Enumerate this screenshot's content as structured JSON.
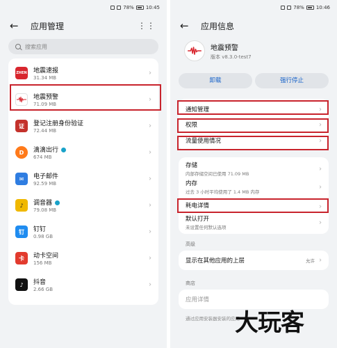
{
  "left": {
    "status": {
      "battery": "78%",
      "time": "10:45"
    },
    "title": "应用管理",
    "more": "⋮⋮",
    "search_placeholder": "搜索应用",
    "apps": [
      {
        "name": "地震速报",
        "size": "31.34 MB",
        "icon_color": "#d8262e",
        "icon_text": "ZHEN"
      },
      {
        "name": "地震预警",
        "size": "71.09 MB",
        "icon_color": "#ffffff",
        "icon_text": ""
      },
      {
        "name": "登记注册身份验证",
        "size": "72.44 MB",
        "icon_color": "#c4322c",
        "icon_text": "证"
      },
      {
        "name": "滴滴出行",
        "size": "674 MB",
        "icon_color": "#ff7a1a",
        "icon_text": "D"
      },
      {
        "name": "电子邮件",
        "size": "92.59 MB",
        "icon_color": "#2f7de1",
        "icon_text": "✉"
      },
      {
        "name": "调音器",
        "size": "79.08 MB",
        "icon_color": "#f0b800",
        "icon_text": "♪"
      },
      {
        "name": "钉钉",
        "size": "0.98 GB",
        "icon_color": "#1f8cf0",
        "icon_text": "钉"
      },
      {
        "name": "动卡空间",
        "size": "156 MB",
        "icon_color": "#e23b2e",
        "icon_text": "卡"
      },
      {
        "name": "抖音",
        "size": "2.66 GB",
        "icon_color": "#111111",
        "icon_text": "♪"
      }
    ]
  },
  "right": {
    "status": {
      "battery": "78%",
      "time": "10:46"
    },
    "title": "应用信息",
    "app_name": "地震预警",
    "app_version": "版本 v8.3.0-test7",
    "uninstall": "卸载",
    "force_stop": "强行停止",
    "rows1": [
      "通知管理",
      "权限",
      "流量使用情况"
    ],
    "storage": {
      "label": "存储",
      "sub": "内部存储空间已使用 71.09 MB"
    },
    "memory": {
      "label": "内存",
      "sub": "过去 3 小时平均使用了 1.4 MB 内存"
    },
    "power": {
      "label": "耗电详情"
    },
    "default_open": {
      "label": "默认打开",
      "sub": "未设置任何默认选项"
    },
    "advanced": "高级",
    "overlay": {
      "label": "显示在其他应用的上层",
      "value": "允许"
    },
    "store": "商店",
    "app_detail": "应用详情",
    "footnote": "通过应用安装器安装的应用",
    "watermark": "大玩客"
  },
  "colors": {
    "highlight": "#c8232c",
    "accent": "#1360c9"
  }
}
